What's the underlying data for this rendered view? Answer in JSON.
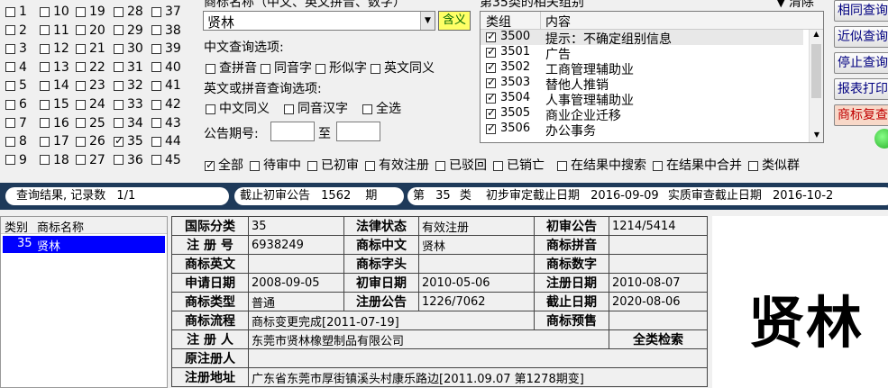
{
  "class_checks": {
    "columns": [
      [
        "1",
        "2",
        "3",
        "4",
        "5",
        "6",
        "7",
        "8",
        "9"
      ],
      [
        "10",
        "11",
        "12",
        "13",
        "14",
        "15",
        "16",
        "17",
        "18"
      ],
      [
        "19",
        "20",
        "21",
        "22",
        "23",
        "24",
        "25",
        "26",
        "27"
      ],
      [
        "28",
        "29",
        "30",
        "31",
        "32",
        "33",
        "34",
        "35",
        "36"
      ],
      [
        "37",
        "38",
        "39",
        "40",
        "41",
        "42",
        "43",
        "44",
        "45"
      ]
    ],
    "checked": [
      "35"
    ]
  },
  "search": {
    "top_label": "商标名称（中文、英文拼音、数字）",
    "value": "贤林",
    "meaning_button": "含义",
    "cn_options_label": "中文查询选项:",
    "cn_options": [
      "查拼音",
      "同音字",
      "形似字",
      "英文同义"
    ],
    "en_options_label": "英文或拼音查询选项:",
    "en_options": [
      "中文同义",
      "同音汉字",
      "全选"
    ],
    "period_label": "公告期号:",
    "period_to": "至"
  },
  "group_panel": {
    "title": "第35类的相关组别",
    "clear_label": "清除",
    "headers": [
      "类组",
      "内容"
    ],
    "rows": [
      {
        "code": "3500",
        "content": "提示：不确定组别信息"
      },
      {
        "code": "3501",
        "content": "广告"
      },
      {
        "code": "3502",
        "content": "工商管理辅助业"
      },
      {
        "code": "3503",
        "content": "替他人推销"
      },
      {
        "code": "3504",
        "content": "人事管理辅助业"
      },
      {
        "code": "3505",
        "content": "商业企业迁移"
      },
      {
        "code": "3506",
        "content": "办公事务"
      }
    ]
  },
  "buttons": [
    "相同查询",
    "近似查询",
    "停止查询",
    "报表打印",
    "商标复查"
  ],
  "filters": [
    "全部",
    "待审中",
    "已初审",
    "有效注册",
    "已驳回",
    "已销亡",
    "在结果中搜索",
    "在结果中合并",
    "类似群"
  ],
  "status_bar": {
    "result_label": "查询结果, 记录数",
    "result_value": "1/1",
    "deadline_label": "截止初审公告",
    "deadline_value": "1562",
    "deadline_unit": "期",
    "class_prefix": "第",
    "class_value": "35",
    "class_suffix": "类",
    "prelim_label": "初步审定截止日期",
    "prelim_value": "2016-09-09",
    "real_label": "实质审查截止日期",
    "real_value": "2016-10-2"
  },
  "result_list": {
    "headers": [
      "类别",
      "商标名称"
    ],
    "rows": [
      {
        "cls": "35",
        "name": "贤林"
      }
    ]
  },
  "detail": {
    "intl_class_label": "国际分类",
    "intl_class": "35",
    "legal_status_label": "法律状态",
    "legal_status": "有效注册",
    "prelim_pub_label": "初审公告",
    "prelim_pub": "1214/5414",
    "reg_no_label": "注 册 号",
    "reg_no": "6938249",
    "cn_name_label": "商标中文",
    "cn_name": "贤林",
    "pinyin_label": "商标拼音",
    "pinyin": "",
    "en_label": "商标英文",
    "en": "",
    "head_label": "商标字头",
    "head": "",
    "num_label": "商标数字",
    "num": "",
    "apply_date_label": "申请日期",
    "apply_date": "2008-09-05",
    "prelim_date_label": "初审日期",
    "prelim_date": "2010-05-06",
    "reg_date_label": "注册日期",
    "reg_date": "2010-08-07",
    "type_label": "商标类型",
    "type": "普通",
    "reg_pub_label": "注册公告",
    "reg_pub": "1226/7062",
    "expire_label": "截止日期",
    "expire": "2020-08-06",
    "flow_label": "商标流程",
    "flow": "商标变更完成[2011-07-19]",
    "forecast_label": "商标预售",
    "forecast": "",
    "registrant_label": "注 册 人",
    "registrant": "东莞市贤林橡塑制品有限公司",
    "all_class_label": "全类检索",
    "orig_registrant_label": "原注册人",
    "orig_registrant": "",
    "address_label": "注册地址",
    "address": "广东省东莞市厚街镇溪头村康乐路边[2011.09.07 第1278期变]"
  },
  "preview_text": "贤林"
}
